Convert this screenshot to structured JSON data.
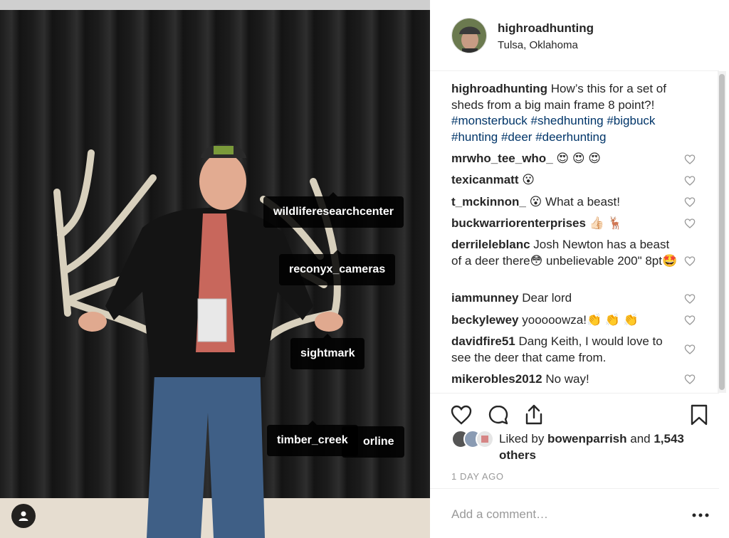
{
  "photo": {
    "tags": [
      {
        "label": "wildliferesearchcenter"
      },
      {
        "label": "reconyx_cameras"
      },
      {
        "label": "sightmark"
      },
      {
        "label": "timber_creek"
      },
      {
        "label": "orline"
      }
    ]
  },
  "header": {
    "username": "highroadhunting",
    "location": "Tulsa, Oklahoma"
  },
  "caption": {
    "username": "highroadhunting",
    "text": " How’s this for a set of sheds from a big main frame 8 point?! ",
    "hashtags": [
      "#monsterbuck",
      "#shedhunting",
      "#bigbuck",
      "#hunting",
      "#deer",
      "#deerhunting"
    ]
  },
  "comments": [
    {
      "user": "mrwho_tee_who_",
      "text": " 😍 😍 😍"
    },
    {
      "user": "texicanmatt",
      "text": " 😮"
    },
    {
      "user": "t_mckinnon_",
      "text": " 😮  What a beast!"
    },
    {
      "user": "buckwarriorenterprises",
      "text": " 👍🏻 🦌"
    },
    {
      "user": "derrileleblanc",
      "text": " Josh Newton has a beast of a deer there😳  unbelievable 200\" 8pt🤩"
    },
    {
      "user": "iammunney",
      "text": " Dear lord"
    },
    {
      "user": "beckylewey",
      "text": " yooooowza!👏 👏 👏"
    },
    {
      "user": "davidfire51",
      "text": " Dang Keith, I would love to see the deer that came from."
    },
    {
      "user": "mikerobles2012",
      "text": " No way!"
    }
  ],
  "likes": {
    "prefix": "Liked by ",
    "user": "bowenparrish",
    "middle": " and ",
    "others": "1,543 others"
  },
  "timestamp": "1 DAY AGO",
  "comment_box": {
    "placeholder": "Add a comment…",
    "more": "•••"
  },
  "colors": {
    "hashtag": "#003569",
    "text": "#262626",
    "muted": "#999999",
    "divider": "#efefef"
  },
  "icons": {
    "like": "heart-icon",
    "comment": "comment-icon",
    "share": "share-icon",
    "save": "bookmark-icon",
    "tagged_users": "user-icon"
  }
}
